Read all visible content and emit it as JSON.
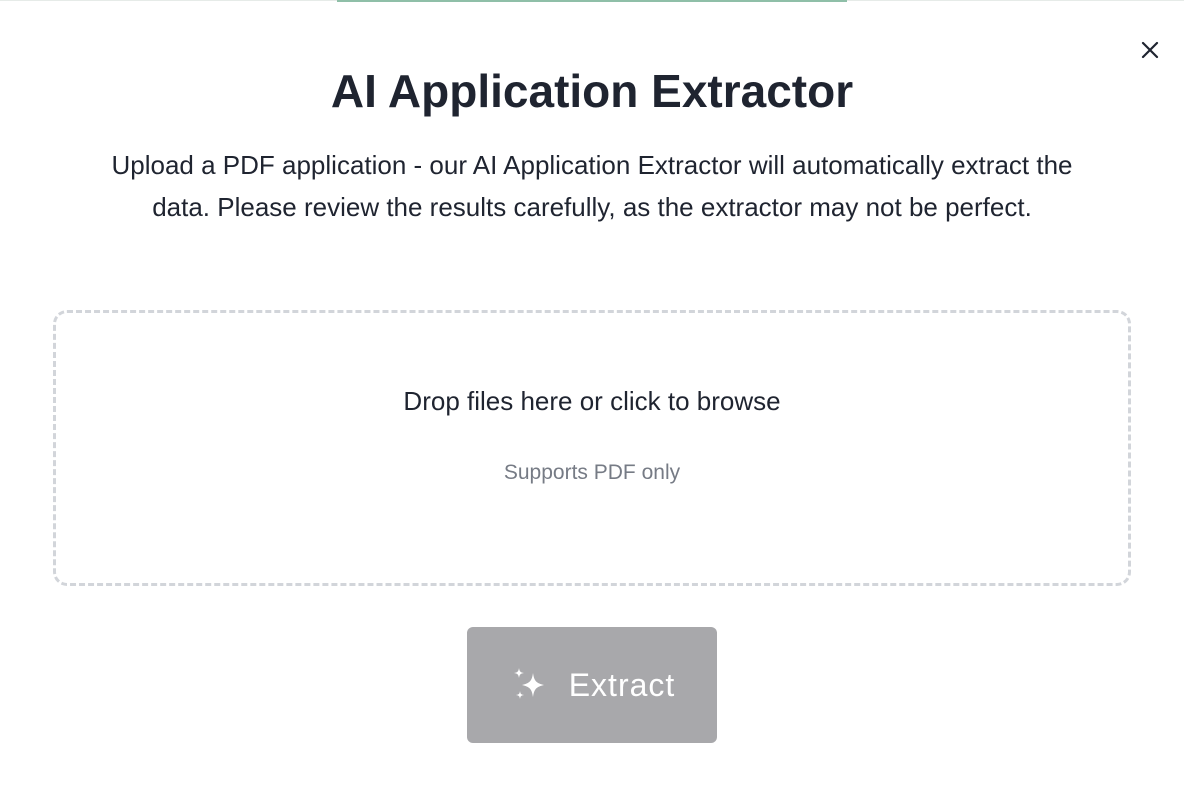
{
  "modal": {
    "title": "AI Application Extractor",
    "description": "Upload a PDF application - our AI Application Extractor will automatically extract the data. Please review the results carefully, as the extractor may not be perfect.",
    "close_icon": "close-icon"
  },
  "dropzone": {
    "prompt": "Drop files here or click to browse",
    "supported": "Supports PDF only"
  },
  "extract_button": {
    "label": "Extract",
    "icon": "sparkles-icon",
    "state": "disabled"
  },
  "colors": {
    "text": "#1f2430",
    "muted_text": "#767b85",
    "dropzone_border": "#d2d5da",
    "button_disabled": "#a8a8ab",
    "accent_bar": "#8fbfa8"
  }
}
